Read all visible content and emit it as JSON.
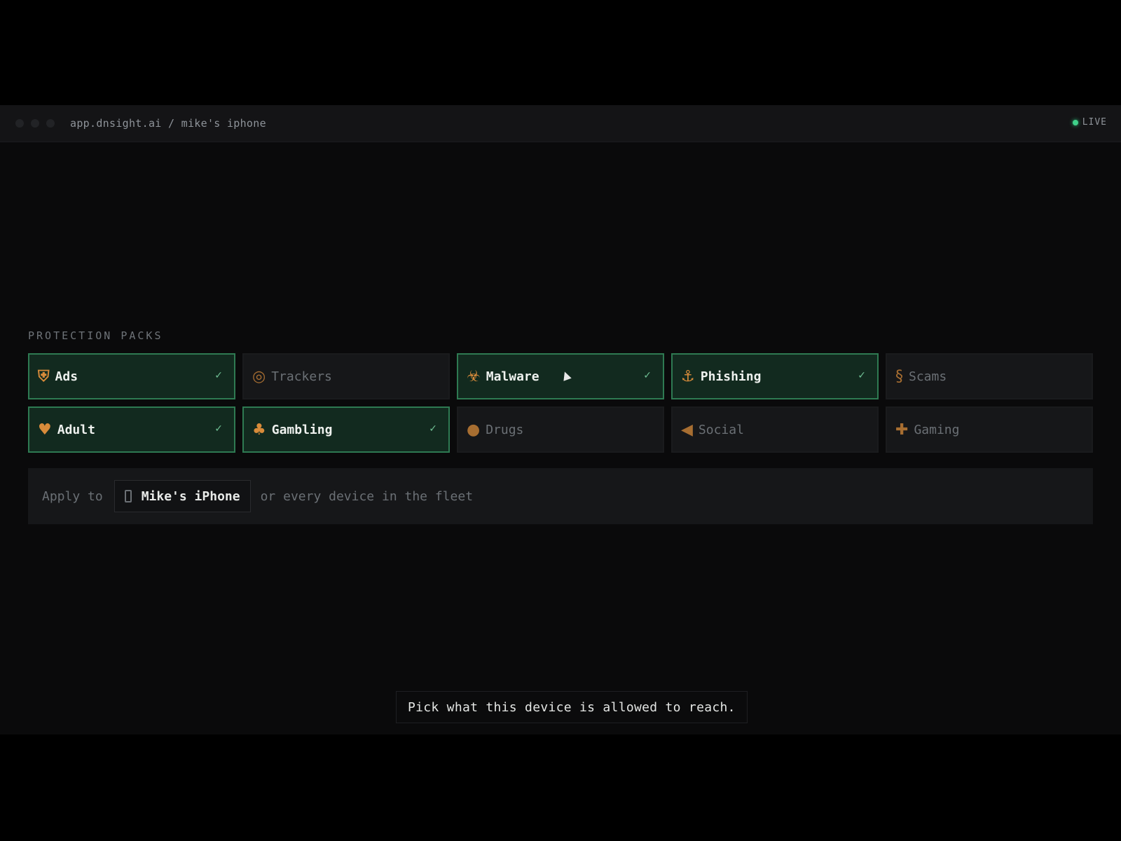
{
  "window": {
    "url": "app.dnsight.ai / mike's iphone",
    "live_label": "LIVE"
  },
  "section": {
    "title": "PROTECTION PACKS"
  },
  "packs": [
    {
      "label": "Ads",
      "icon": "shield-icon",
      "glyph": "⛨",
      "enabled": true
    },
    {
      "label": "Trackers",
      "icon": "target-icon",
      "glyph": "◎",
      "enabled": false
    },
    {
      "label": "Malware",
      "icon": "biohazard-icon",
      "glyph": "☣",
      "enabled": true
    },
    {
      "label": "Phishing",
      "icon": "fishing-icon",
      "glyph": "⚓",
      "enabled": true
    },
    {
      "label": "Scams",
      "icon": "snake-icon",
      "glyph": "§",
      "enabled": false
    },
    {
      "label": "Adult",
      "icon": "adult-icon",
      "glyph": "♥",
      "enabled": true
    },
    {
      "label": "Gambling",
      "icon": "slot-machine-icon",
      "glyph": "♣",
      "enabled": true
    },
    {
      "label": "Drugs",
      "icon": "pill-icon",
      "glyph": "●",
      "enabled": false
    },
    {
      "label": "Social",
      "icon": "megaphone-icon",
      "glyph": "◀",
      "enabled": false
    },
    {
      "label": "Gaming",
      "icon": "gamepad-icon",
      "glyph": "✚",
      "enabled": false
    }
  ],
  "check_glyph": "✓",
  "apply": {
    "prefix": "Apply to",
    "device": "Mike's iPhone",
    "suffix": "or every device in the fleet"
  },
  "caption": "Pick what this device is allowed to reach.",
  "colors": {
    "accent": "#2e7a52",
    "enabled_bg": "#122a1f",
    "live_dot": "#3fd18a"
  }
}
